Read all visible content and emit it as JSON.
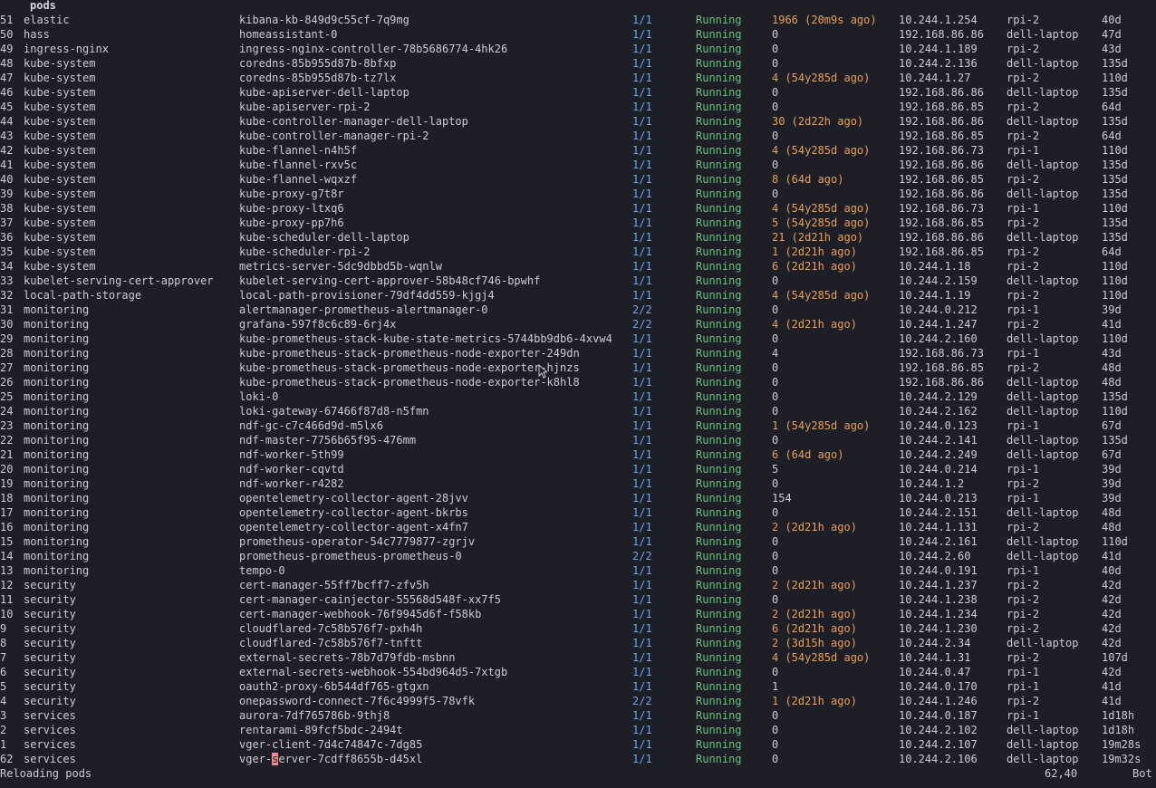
{
  "header": {
    "title": "pods"
  },
  "rows": [
    {
      "ln": "51",
      "ns": "elastic",
      "name": "kibana-kb-849d9c55cf-7q9mg",
      "ready": "1/1",
      "status": "Running",
      "restarts": "1966 (20m9s ago)",
      "ip": "10.244.1.254",
      "node": "rpi-2",
      "age": "40d"
    },
    {
      "ln": "50",
      "ns": "hass",
      "name": "homeassistant-0",
      "ready": "1/1",
      "status": "Running",
      "restarts": "0",
      "ip": "192.168.86.86",
      "node": "dell-laptop",
      "age": "47d"
    },
    {
      "ln": "49",
      "ns": "ingress-nginx",
      "name": "ingress-nginx-controller-78b5686774-4hk26",
      "ready": "1/1",
      "status": "Running",
      "restarts": "0",
      "ip": "10.244.1.189",
      "node": "rpi-2",
      "age": "43d"
    },
    {
      "ln": "48",
      "ns": "kube-system",
      "name": "coredns-85b955d87b-8bfxp",
      "ready": "1/1",
      "status": "Running",
      "restarts": "0",
      "ip": "10.244.2.136",
      "node": "dell-laptop",
      "age": "135d"
    },
    {
      "ln": "47",
      "ns": "kube-system",
      "name": "coredns-85b955d87b-tz7lx",
      "ready": "1/1",
      "status": "Running",
      "restarts": "4 (54y285d ago)",
      "ip": "10.244.1.27",
      "node": "rpi-2",
      "age": "110d"
    },
    {
      "ln": "46",
      "ns": "kube-system",
      "name": "kube-apiserver-dell-laptop",
      "ready": "1/1",
      "status": "Running",
      "restarts": "0",
      "ip": "192.168.86.86",
      "node": "dell-laptop",
      "age": "135d"
    },
    {
      "ln": "45",
      "ns": "kube-system",
      "name": "kube-apiserver-rpi-2",
      "ready": "1/1",
      "status": "Running",
      "restarts": "0",
      "ip": "192.168.86.85",
      "node": "rpi-2",
      "age": "64d"
    },
    {
      "ln": "44",
      "ns": "kube-system",
      "name": "kube-controller-manager-dell-laptop",
      "ready": "1/1",
      "status": "Running",
      "restarts": "30 (2d22h ago)",
      "ip": "192.168.86.86",
      "node": "dell-laptop",
      "age": "135d"
    },
    {
      "ln": "43",
      "ns": "kube-system",
      "name": "kube-controller-manager-rpi-2",
      "ready": "1/1",
      "status": "Running",
      "restarts": "0",
      "ip": "192.168.86.85",
      "node": "rpi-2",
      "age": "64d"
    },
    {
      "ln": "42",
      "ns": "kube-system",
      "name": "kube-flannel-n4h5f",
      "ready": "1/1",
      "status": "Running",
      "restarts": "4 (54y285d ago)",
      "ip": "192.168.86.73",
      "node": "rpi-1",
      "age": "110d"
    },
    {
      "ln": "41",
      "ns": "kube-system",
      "name": "kube-flannel-rxv5c",
      "ready": "1/1",
      "status": "Running",
      "restarts": "0",
      "ip": "192.168.86.86",
      "node": "dell-laptop",
      "age": "135d"
    },
    {
      "ln": "40",
      "ns": "kube-system",
      "name": "kube-flannel-wqxzf",
      "ready": "1/1",
      "status": "Running",
      "restarts": "8 (64d ago)",
      "ip": "192.168.86.85",
      "node": "rpi-2",
      "age": "135d"
    },
    {
      "ln": "39",
      "ns": "kube-system",
      "name": "kube-proxy-g7t8r",
      "ready": "1/1",
      "status": "Running",
      "restarts": "0",
      "ip": "192.168.86.86",
      "node": "dell-laptop",
      "age": "135d"
    },
    {
      "ln": "38",
      "ns": "kube-system",
      "name": "kube-proxy-ltxq6",
      "ready": "1/1",
      "status": "Running",
      "restarts": "4 (54y285d ago)",
      "ip": "192.168.86.73",
      "node": "rpi-1",
      "age": "110d"
    },
    {
      "ln": "37",
      "ns": "kube-system",
      "name": "kube-proxy-pp7h6",
      "ready": "1/1",
      "status": "Running",
      "restarts": "5 (54y285d ago)",
      "ip": "192.168.86.85",
      "node": "rpi-2",
      "age": "135d"
    },
    {
      "ln": "36",
      "ns": "kube-system",
      "name": "kube-scheduler-dell-laptop",
      "ready": "1/1",
      "status": "Running",
      "restarts": "21 (2d21h ago)",
      "ip": "192.168.86.86",
      "node": "dell-laptop",
      "age": "135d"
    },
    {
      "ln": "35",
      "ns": "kube-system",
      "name": "kube-scheduler-rpi-2",
      "ready": "1/1",
      "status": "Running",
      "restarts": "1 (2d21h ago)",
      "ip": "192.168.86.85",
      "node": "rpi-2",
      "age": "64d"
    },
    {
      "ln": "34",
      "ns": "kube-system",
      "name": "metrics-server-5dc9dbbd5b-wqnlw",
      "ready": "1/1",
      "status": "Running",
      "restarts": "6 (2d21h ago)",
      "ip": "10.244.1.18",
      "node": "rpi-2",
      "age": "110d"
    },
    {
      "ln": "33",
      "ns": "kubelet-serving-cert-approver",
      "name": "kubelet-serving-cert-approver-58b48cf746-bpwhf",
      "ready": "1/1",
      "status": "Running",
      "restarts": "0",
      "ip": "10.244.2.159",
      "node": "dell-laptop",
      "age": "110d"
    },
    {
      "ln": "32",
      "ns": "local-path-storage",
      "name": "local-path-provisioner-79df4dd559-kjgj4",
      "ready": "1/1",
      "status": "Running",
      "restarts": "4 (54y285d ago)",
      "ip": "10.244.1.19",
      "node": "rpi-2",
      "age": "110d"
    },
    {
      "ln": "31",
      "ns": "monitoring",
      "name": "alertmanager-prometheus-alertmanager-0",
      "ready": "2/2",
      "status": "Running",
      "restarts": "0",
      "ip": "10.244.0.212",
      "node": "rpi-1",
      "age": "39d"
    },
    {
      "ln": "30",
      "ns": "monitoring",
      "name": "grafana-597f8c6c89-6rj4x",
      "ready": "2/2",
      "status": "Running",
      "restarts": "4 (2d21h ago)",
      "ip": "10.244.1.247",
      "node": "rpi-2",
      "age": "41d"
    },
    {
      "ln": "29",
      "ns": "monitoring",
      "name": "kube-prometheus-stack-kube-state-metrics-5744bb9db6-4xvw4",
      "ready": "1/1",
      "status": "Running",
      "restarts": "0",
      "ip": "10.244.2.160",
      "node": "dell-laptop",
      "age": "110d"
    },
    {
      "ln": "28",
      "ns": "monitoring",
      "name": "kube-prometheus-stack-prometheus-node-exporter-249dn",
      "ready": "1/1",
      "status": "Running",
      "restarts": "4",
      "ip": "192.168.86.73",
      "node": "rpi-1",
      "age": "43d"
    },
    {
      "ln": "27",
      "ns": "monitoring",
      "name": "kube-prometheus-stack-prometheus-node-exporter-hjnzs",
      "ready": "1/1",
      "status": "Running",
      "restarts": "0",
      "ip": "192.168.86.85",
      "node": "rpi-2",
      "age": "48d"
    },
    {
      "ln": "26",
      "ns": "monitoring",
      "name": "kube-prometheus-stack-prometheus-node-exporter-k8hl8",
      "ready": "1/1",
      "status": "Running",
      "restarts": "0",
      "ip": "192.168.86.86",
      "node": "dell-laptop",
      "age": "48d"
    },
    {
      "ln": "25",
      "ns": "monitoring",
      "name": "loki-0",
      "ready": "1/1",
      "status": "Running",
      "restarts": "0",
      "ip": "10.244.2.129",
      "node": "dell-laptop",
      "age": "135d"
    },
    {
      "ln": "24",
      "ns": "monitoring",
      "name": "loki-gateway-67466f87d8-n5fmn",
      "ready": "1/1",
      "status": "Running",
      "restarts": "0",
      "ip": "10.244.2.162",
      "node": "dell-laptop",
      "age": "110d"
    },
    {
      "ln": "23",
      "ns": "monitoring",
      "name": "ndf-gc-c7c466d9d-m5lx6",
      "ready": "1/1",
      "status": "Running",
      "restarts": "1 (54y285d ago)",
      "ip": "10.244.0.123",
      "node": "rpi-1",
      "age": "67d"
    },
    {
      "ln": "22",
      "ns": "monitoring",
      "name": "ndf-master-7756b65f95-476mm",
      "ready": "1/1",
      "status": "Running",
      "restarts": "0",
      "ip": "10.244.2.141",
      "node": "dell-laptop",
      "age": "135d"
    },
    {
      "ln": "21",
      "ns": "monitoring",
      "name": "ndf-worker-5th99",
      "ready": "1/1",
      "status": "Running",
      "restarts": "6 (64d ago)",
      "ip": "10.244.2.249",
      "node": "dell-laptop",
      "age": "67d"
    },
    {
      "ln": "20",
      "ns": "monitoring",
      "name": "ndf-worker-cqvtd",
      "ready": "1/1",
      "status": "Running",
      "restarts": "5",
      "ip": "10.244.0.214",
      "node": "rpi-1",
      "age": "39d"
    },
    {
      "ln": "19",
      "ns": "monitoring",
      "name": "ndf-worker-r4282",
      "ready": "1/1",
      "status": "Running",
      "restarts": "0",
      "ip": "10.244.1.2",
      "node": "rpi-2",
      "age": "39d"
    },
    {
      "ln": "18",
      "ns": "monitoring",
      "name": "opentelemetry-collector-agent-28jvv",
      "ready": "1/1",
      "status": "Running",
      "restarts": "154",
      "ip": "10.244.0.213",
      "node": "rpi-1",
      "age": "39d"
    },
    {
      "ln": "17",
      "ns": "monitoring",
      "name": "opentelemetry-collector-agent-bkrbs",
      "ready": "1/1",
      "status": "Running",
      "restarts": "0",
      "ip": "10.244.2.151",
      "node": "dell-laptop",
      "age": "48d"
    },
    {
      "ln": "16",
      "ns": "monitoring",
      "name": "opentelemetry-collector-agent-x4fn7",
      "ready": "1/1",
      "status": "Running",
      "restarts": "2 (2d21h ago)",
      "ip": "10.244.1.131",
      "node": "rpi-2",
      "age": "48d"
    },
    {
      "ln": "15",
      "ns": "monitoring",
      "name": "prometheus-operator-54c7779877-zgrjv",
      "ready": "1/1",
      "status": "Running",
      "restarts": "0",
      "ip": "10.244.2.161",
      "node": "dell-laptop",
      "age": "110d"
    },
    {
      "ln": "14",
      "ns": "monitoring",
      "name": "prometheus-prometheus-prometheus-0",
      "ready": "2/2",
      "status": "Running",
      "restarts": "0",
      "ip": "10.244.2.60",
      "node": "dell-laptop",
      "age": "41d"
    },
    {
      "ln": "13",
      "ns": "monitoring",
      "name": "tempo-0",
      "ready": "1/1",
      "status": "Running",
      "restarts": "0",
      "ip": "10.244.0.191",
      "node": "rpi-1",
      "age": "40d"
    },
    {
      "ln": "12",
      "ns": "security",
      "name": "cert-manager-55ff7bcff7-zfv5h",
      "ready": "1/1",
      "status": "Running",
      "restarts": "2 (2d21h ago)",
      "ip": "10.244.1.237",
      "node": "rpi-2",
      "age": "42d"
    },
    {
      "ln": "11",
      "ns": "security",
      "name": "cert-manager-cainjector-55568d548f-xx7f5",
      "ready": "1/1",
      "status": "Running",
      "restarts": "0",
      "ip": "10.244.1.238",
      "node": "rpi-2",
      "age": "42d"
    },
    {
      "ln": "10",
      "ns": "security",
      "name": "cert-manager-webhook-76f9945d6f-f58kb",
      "ready": "1/1",
      "status": "Running",
      "restarts": "2 (2d21h ago)",
      "ip": "10.244.1.234",
      "node": "rpi-2",
      "age": "42d"
    },
    {
      "ln": "9",
      "ns": "security",
      "name": "cloudflared-7c58b576f7-pxh4h",
      "ready": "1/1",
      "status": "Running",
      "restarts": "6 (2d21h ago)",
      "ip": "10.244.1.230",
      "node": "rpi-2",
      "age": "42d"
    },
    {
      "ln": "8",
      "ns": "security",
      "name": "cloudflared-7c58b576f7-tnftt",
      "ready": "1/1",
      "status": "Running",
      "restarts": "2 (3d15h ago)",
      "ip": "10.244.2.34",
      "node": "dell-laptop",
      "age": "42d"
    },
    {
      "ln": "7",
      "ns": "security",
      "name": "external-secrets-78b7d79fdb-msbnn",
      "ready": "1/1",
      "status": "Running",
      "restarts": "4 (54y285d ago)",
      "ip": "10.244.1.31",
      "node": "rpi-2",
      "age": "107d"
    },
    {
      "ln": "6",
      "ns": "security",
      "name": "external-secrets-webhook-554bd964d5-7xtgb",
      "ready": "1/1",
      "status": "Running",
      "restarts": "0",
      "ip": "10.244.0.47",
      "node": "rpi-1",
      "age": "42d"
    },
    {
      "ln": "5",
      "ns": "security",
      "name": "oauth2-proxy-6b544df765-gtgxn",
      "ready": "1/1",
      "status": "Running",
      "restarts": "1",
      "ip": "10.244.0.170",
      "node": "rpi-1",
      "age": "41d"
    },
    {
      "ln": "4",
      "ns": "security",
      "name": "onepassword-connect-7f6c4999f5-78vfk",
      "ready": "2/2",
      "status": "Running",
      "restarts": "1 (2d21h ago)",
      "ip": "10.244.1.246",
      "node": "rpi-2",
      "age": "41d"
    },
    {
      "ln": "3",
      "ns": "services",
      "name": "aurora-7df765786b-9thj8",
      "ready": "1/1",
      "status": "Running",
      "restarts": "0",
      "ip": "10.244.0.187",
      "node": "rpi-1",
      "age": "1d18h"
    },
    {
      "ln": "2",
      "ns": "services",
      "name": "rentarami-89fcf5bdc-2494t",
      "ready": "1/1",
      "status": "Running",
      "restarts": "0",
      "ip": "10.244.2.102",
      "node": "dell-laptop",
      "age": "1d18h"
    },
    {
      "ln": "1",
      "ns": "services",
      "name": "vger-client-7d4c74847c-7dg85",
      "ready": "1/1",
      "status": "Running",
      "restarts": "0",
      "ip": "10.244.2.107",
      "node": "dell-laptop",
      "age": "19m28s"
    },
    {
      "ln": "62",
      "ns": "services",
      "name": "vger-server-7cdff8655b-d45xl",
      "ready": "1/1",
      "status": "Running",
      "restarts": "0",
      "ip": "10.244.2.106",
      "node": "dell-laptop",
      "age": "19m32s",
      "current": true
    }
  ],
  "cursor": {
    "row": 51,
    "col": 5
  },
  "status_line": {
    "message": "Reloading pods",
    "position": "62,40",
    "scroll": "Bot"
  },
  "colors": {
    "background": "#1e1f26",
    "text": "#c9ccd4",
    "ready": "#6aa7e4",
    "running": "#65c27b",
    "restarts_warn": "#e4a05a",
    "cursor": "#f28a8a"
  }
}
